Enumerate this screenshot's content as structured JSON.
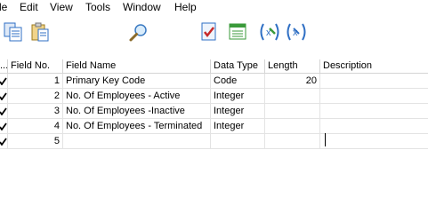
{
  "menu": [
    "le",
    "Edit",
    "View",
    "Tools",
    "Window",
    "Help"
  ],
  "toolbar": {
    "buttons": [
      "copy-icon",
      "paste-icon",
      "find-icon",
      "design-icon",
      "run-icon",
      "zoom-icon",
      "zoom-out-icon"
    ]
  },
  "table": {
    "columns": [
      "...",
      "Field No.",
      "Field Name",
      "Data Type",
      "Length",
      "Description"
    ],
    "rows": [
      {
        "no": "1",
        "name": "Primary Key Code",
        "type": "Code",
        "length": "20",
        "description": ""
      },
      {
        "no": "2",
        "name": "No. Of Employees - Active",
        "type": "Integer",
        "length": "",
        "description": ""
      },
      {
        "no": "3",
        "name": "No. Of Employees -Inactive",
        "type": "Integer",
        "length": "",
        "description": ""
      },
      {
        "no": "4",
        "name": "No. Of Employees - Terminated",
        "type": "Integer",
        "length": "",
        "description": ""
      },
      {
        "no": "5",
        "name": "",
        "type": "",
        "length": "",
        "description": ""
      }
    ]
  },
  "colors": {
    "grid_line": "#e3e3e3",
    "header_line": "#d4d4d4",
    "icon_blue": "#2f6fc4",
    "icon_green": "#3a9a3a",
    "icon_red": "#c62828"
  }
}
